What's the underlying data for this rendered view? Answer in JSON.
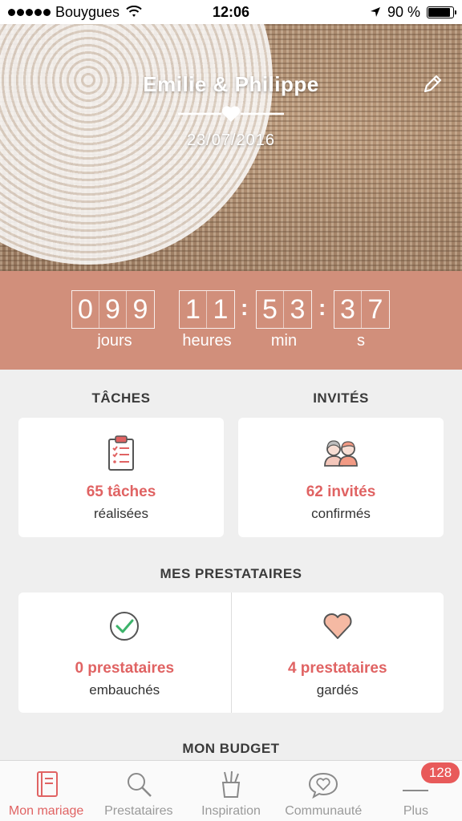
{
  "status_bar": {
    "carrier": "Bouygues",
    "time": "12:06",
    "battery": "90 %"
  },
  "hero": {
    "couple_names": "Emilie & Philippe",
    "date": "23/07/2016"
  },
  "countdown": {
    "days": [
      "0",
      "9",
      "9"
    ],
    "hours": [
      "1",
      "1"
    ],
    "minutes": [
      "5",
      "3"
    ],
    "seconds": [
      "3",
      "7"
    ],
    "labels": {
      "days": "jours",
      "hours": "heures",
      "minutes": "min",
      "seconds": "s"
    }
  },
  "tasks": {
    "title": "TÂCHES",
    "count": "65 tâches",
    "sub": "réalisées"
  },
  "guests": {
    "title": "INVITÉS",
    "count": "62 invités",
    "sub": "confirmés"
  },
  "vendors": {
    "title": "MES PRESTATAIRES",
    "hired": {
      "count": "0 prestataires",
      "sub": "embauchés"
    },
    "saved": {
      "count": "4 prestataires",
      "sub": "gardés"
    }
  },
  "budget": {
    "title": "MON BUDGET"
  },
  "tab_bar": {
    "items": [
      {
        "label": "Mon mariage",
        "icon": "notebook-icon",
        "active": true
      },
      {
        "label": "Prestataires",
        "icon": "search-icon",
        "active": false
      },
      {
        "label": "Inspiration",
        "icon": "pencil-cup-icon",
        "active": false
      },
      {
        "label": "Communauté",
        "icon": "chat-heart-icon",
        "active": false
      },
      {
        "label": "Plus",
        "icon": "menu-icon",
        "active": false,
        "badge": "128"
      }
    ]
  },
  "colors": {
    "accent": "#e06363",
    "countdown_bg": "#d18f7b",
    "background": "#efefef"
  }
}
